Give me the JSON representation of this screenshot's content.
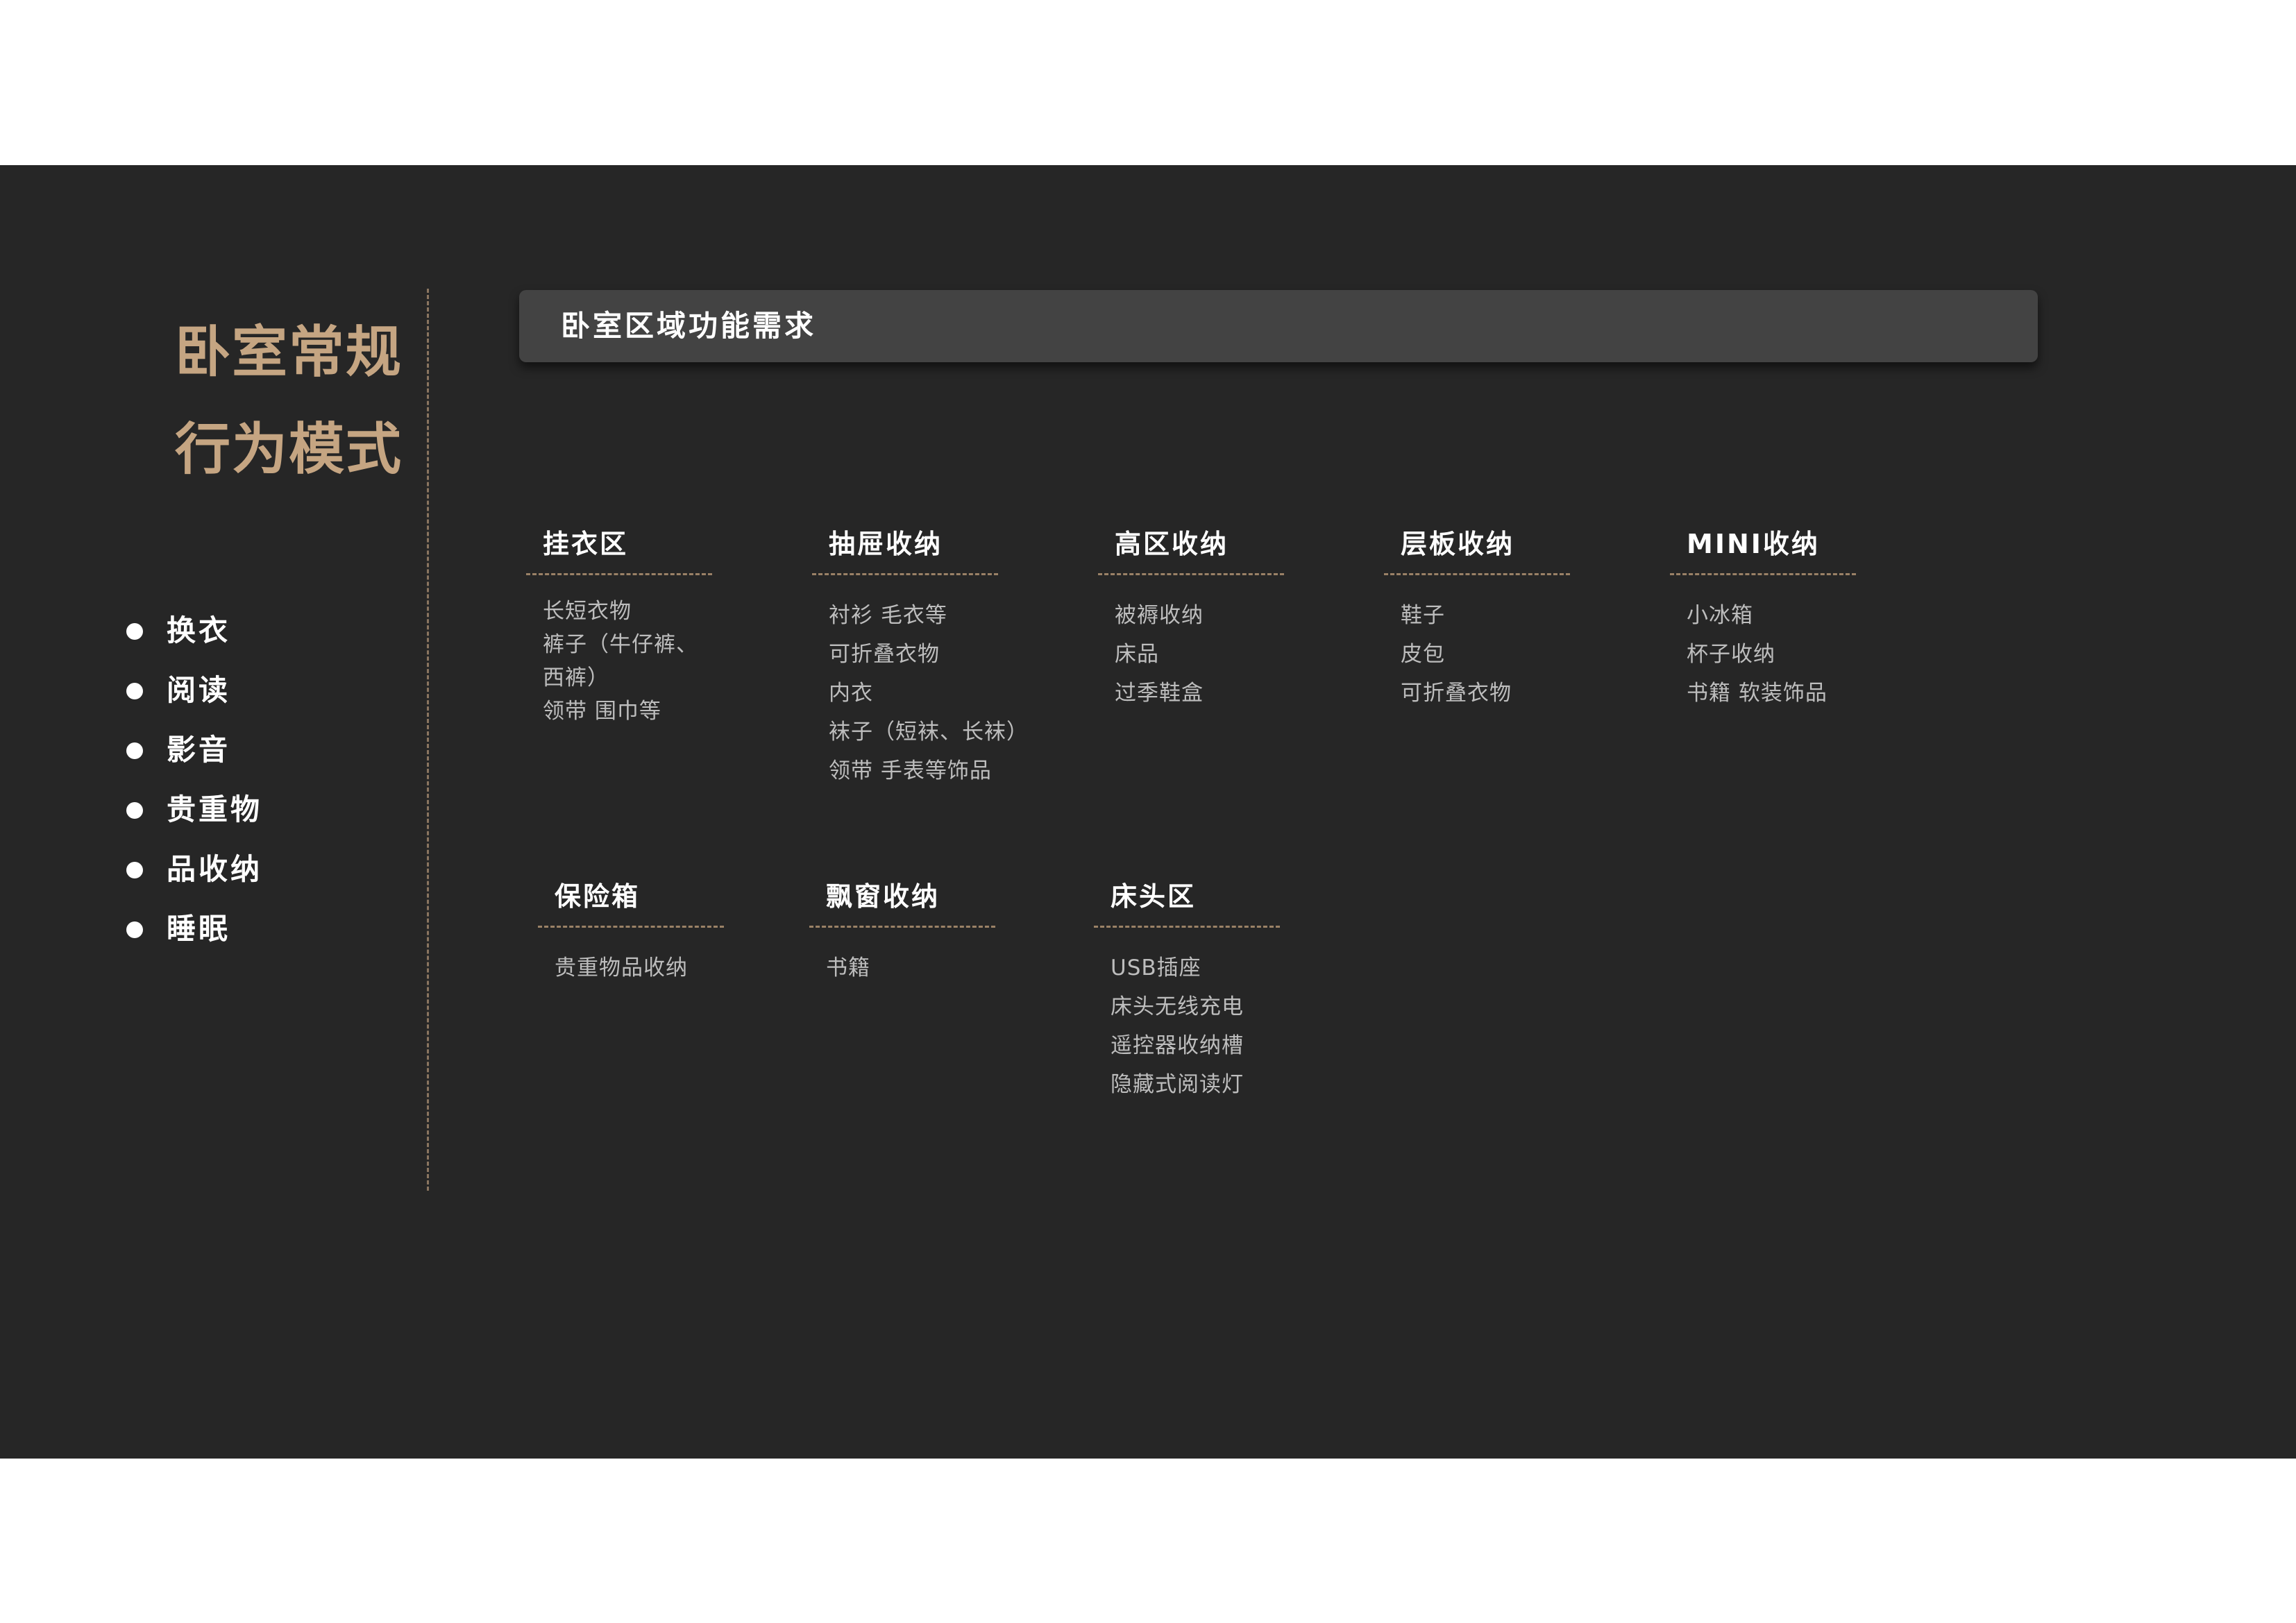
{
  "page": {
    "title_lines": [
      "卧室常规",
      "行为模式"
    ],
    "bullets": [
      "换衣",
      "阅读",
      "影音",
      "贵重物",
      "品收纳",
      "睡眠"
    ],
    "header": "卧室区域功能需求"
  },
  "categories": [
    {
      "title": "挂衣区",
      "items": [
        "长短衣物",
        "裤子（牛仔裤、",
        "西裤）",
        "领带 围巾等"
      ]
    },
    {
      "title": "抽屉收纳",
      "items": [
        "衬衫 毛衣等",
        "可折叠衣物",
        "内衣",
        "袜子（短袜、长袜）",
        "领带 手表等饰品"
      ]
    },
    {
      "title": "高区收纳",
      "items": [
        "被褥收纳",
        "床品",
        "过季鞋盒"
      ]
    },
    {
      "title": "层板收纳",
      "items": [
        "鞋子",
        "皮包",
        "可折叠衣物"
      ]
    },
    {
      "title": "MINI收纳",
      "items": [
        "小冰箱",
        "杯子收纳",
        "书籍 软装饰品"
      ]
    },
    {
      "title": "保险箱",
      "items": [
        "贵重物品收纳"
      ]
    },
    {
      "title": "飘窗收纳",
      "items": [
        "书籍"
      ]
    },
    {
      "title": "床头区",
      "items": [
        "USB插座",
        "床头无线充电",
        "遥控器收纳槽",
        "隐藏式阅读灯"
      ]
    }
  ],
  "colors": {
    "background": "#262626",
    "title_accent": "#c5a582",
    "header_bar": "#434343",
    "text_primary": "#ffffff",
    "text_secondary": "#bdbdbd"
  }
}
